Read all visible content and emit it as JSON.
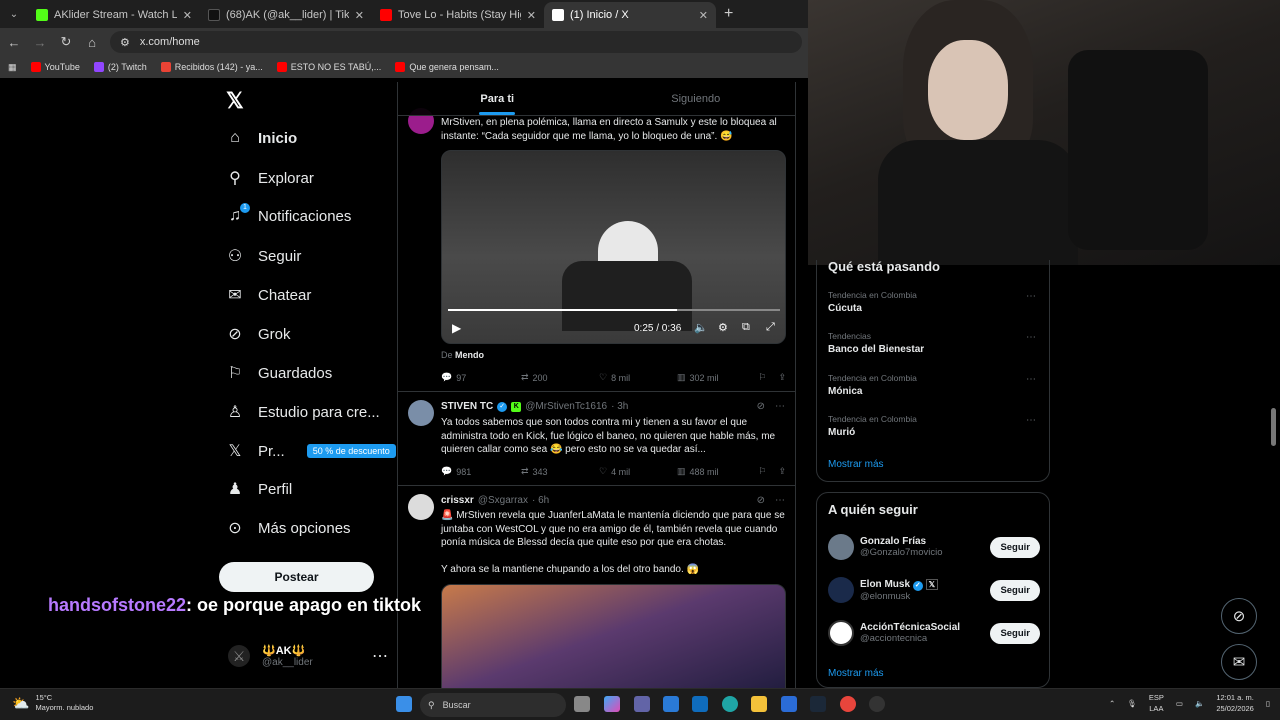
{
  "browser": {
    "tabs": [
      {
        "title": "AKlider Stream - Watch Live on",
        "color": "#53fc18",
        "active": false
      },
      {
        "title": "(68)AK (@ak__lider) | TikTok",
        "color": "#111111",
        "active": false
      },
      {
        "title": "Tove Lo - Habits (Stay High) - H",
        "color": "#ff0000",
        "active": false
      },
      {
        "title": "(1) Inicio / X",
        "color": "#ffffff",
        "active": true
      }
    ],
    "url": "x.com/home",
    "bookmarks": [
      {
        "label": "YouTube",
        "color": "#ff0000"
      },
      {
        "label": "(2) Twitch",
        "color": "#9146ff"
      },
      {
        "label": "Recibidos (142) - ya...",
        "color": "#ea4335"
      },
      {
        "label": "ESTO NO ES TABÚ,...",
        "color": "#ff0000"
      },
      {
        "label": "Que genera pensam...",
        "color": "#ff0000"
      }
    ]
  },
  "sidebar": {
    "items": [
      {
        "label": "Inicio",
        "icon": "home-icon",
        "glyph": "⌂"
      },
      {
        "label": "Explorar",
        "icon": "search-icon",
        "glyph": "⚲"
      },
      {
        "label": "Notificaciones",
        "icon": "bell-icon",
        "glyph": "🔔"
      },
      {
        "label": "Seguir",
        "icon": "add-person-icon",
        "glyph": "👤"
      },
      {
        "label": "Chatear",
        "icon": "mail-icon",
        "glyph": "✉"
      },
      {
        "label": "Grok",
        "icon": "grok-icon",
        "glyph": "⊘"
      },
      {
        "label": "Guardados",
        "icon": "bookmark-icon",
        "glyph": "⌑"
      },
      {
        "label": "Estudio para cre...",
        "icon": "studio-icon",
        "glyph": "♙"
      },
      {
        "label": "Pr...",
        "icon": "x-premium-icon",
        "glyph": "𝕏"
      },
      {
        "label": "Perfil",
        "icon": "profile-icon",
        "glyph": "👤"
      },
      {
        "label": "Más opciones",
        "icon": "more-options-icon",
        "glyph": "⋯"
      }
    ],
    "notif_badge": "1",
    "promo": "50 % de descuento",
    "post_button": "Postear",
    "account": {
      "name": "🔱AK🔱",
      "handle": "@ak__lider"
    }
  },
  "chat_overlay": {
    "user": "handsofstone22",
    "message": ": oe porque apago en tiktok"
  },
  "feed": {
    "tabs": [
      "Para ti",
      "Siguiendo"
    ],
    "posts": [
      {
        "text": "MrStiven, en plena polémica, llama en directo a Samulx y este lo bloquea al instante: “Cada seguidor que me llama, yo lo bloqueo de una”. 😅",
        "video_time": "0:25 / 0:36",
        "video_progress": 0.69,
        "source_prefix": "De",
        "source": "Mendo",
        "stats": {
          "replies": "97",
          "reposts": "200",
          "likes": "8 mil",
          "views": "302 mil"
        }
      },
      {
        "name": "STIVEN TC",
        "handle": "@MrStivenTc1616",
        "time": "· 3h",
        "text": "Ya todos sabemos que son todos contra mi y tienen a su favor el que administra todo en Kick, fue lógico el baneo, no quieren que hable más, me quieren callar como sea 😂 pero esto no se va quedar así...",
        "stats": {
          "replies": "981",
          "reposts": "343",
          "likes": "4 mil",
          "views": "488 mil"
        }
      },
      {
        "name": "crissxr",
        "handle": "@Sxgarrax",
        "time": "· 6h",
        "text": "🚨 MrStiven revela que JuanferLaMata le mantenía diciendo que para que se juntaba con WestCOL y que no era amigo de él, también revela que cuando ponía música de Blessd decía que quite eso por que era chotas.",
        "text2": "Y ahora se la mantiene chupando a los del otro bando. 😱"
      }
    ]
  },
  "trends": {
    "title": "Qué está pasando",
    "items": [
      {
        "meta": "Tendencia en Colombia",
        "name": "Cúcuta"
      },
      {
        "meta": "Tendencias",
        "name": "Banco del Bienestar"
      },
      {
        "meta": "Tendencia en Colombia",
        "name": "Mónica"
      },
      {
        "meta": "Tendencia en Colombia",
        "name": "Murió"
      }
    ],
    "show_more": "Mostrar más"
  },
  "who_to_follow": {
    "title": "A quién seguir",
    "items": [
      {
        "name": "Gonzalo Frías",
        "handle": "@Gonzalo7movicio",
        "button": "Seguir",
        "color": "#6b7a8a"
      },
      {
        "name": "Elon Musk",
        "handle": "@elonmusk",
        "button": "Seguir",
        "color": "#1a2a4a"
      },
      {
        "name": "AcciónTécnicaSocial",
        "handle": "@acciontecnica",
        "button": "Seguir",
        "color": "#ffffff"
      }
    ],
    "show_more": "Mostrar más"
  },
  "taskbar": {
    "weather_temp": "15°C",
    "weather_desc": "Mayorm. nublado",
    "search_placeholder": "Buscar",
    "lang1": "ESP",
    "lang2": "LAA",
    "time": "12:01 a. m.",
    "date": "25/02/2026"
  }
}
